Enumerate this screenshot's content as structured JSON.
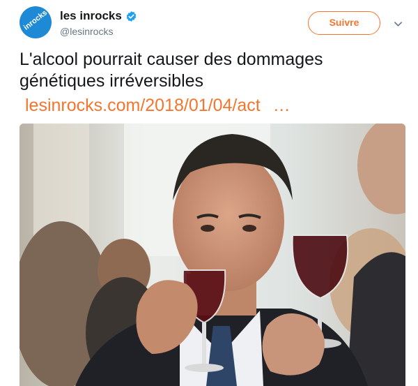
{
  "account": {
    "avatar_text": "inrocks",
    "display_name": "les inrocks",
    "handle": "@lesinrocks",
    "verified": true
  },
  "actions": {
    "follow_label": "Suivre",
    "menu_icon": "chevron-down-icon"
  },
  "tweet": {
    "text": "L'alcool pourrait causer des dommages génétiques irréversibles",
    "link": "lesinrocks.com/2018/01/04/act",
    "link_ellipsis": "…"
  },
  "colors": {
    "accent": "#f4752e",
    "avatar_bg": "#1e8ad6",
    "verified": "#1da1f2",
    "handle": "#657786"
  }
}
